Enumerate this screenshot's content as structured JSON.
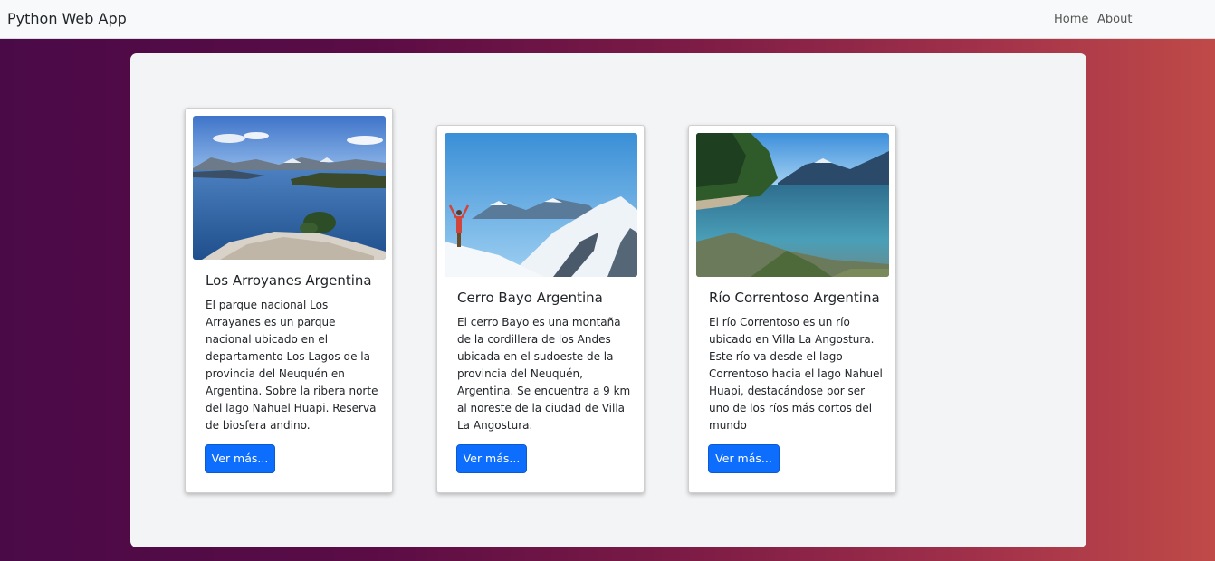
{
  "navbar": {
    "brand": "Python Web App",
    "links": [
      "Home",
      "About"
    ]
  },
  "cards": [
    {
      "title": "Los Arroyanes Argentina",
      "text": "El parque nacional Los Arrayanes es un parque nacional ubicado en el departamento Los Lagos de la provincia del Neuquén en Argentina. Sobre la ribera norte del lago Nahuel Huapi. Reserva de biosfera andino.",
      "button": "Ver más..."
    },
    {
      "title": "Cerro Bayo Argentina",
      "text": "El cerro Bayo es una montaña de la cordillera de los Andes ubicada en el sudoeste de la provincia del Neuquén, Argentina. Se encuentra a 9 km al noreste de la ciudad de Villa La Angostura.",
      "button": "Ver más..."
    },
    {
      "title": "Río Correntoso Argentina",
      "text": "El río Correntoso es un río ubicado en Villa La Angostura. Este río va desde el lago Correntoso hacia el lago Nahuel Huapi, destacándose por ser uno de los ríos más cortos del mundo",
      "button": "Ver más..."
    }
  ],
  "colors": {
    "primary_button": "#0d6efd",
    "navbar_bg": "#f8f9fa",
    "panel_bg": "#f3f4f6"
  }
}
